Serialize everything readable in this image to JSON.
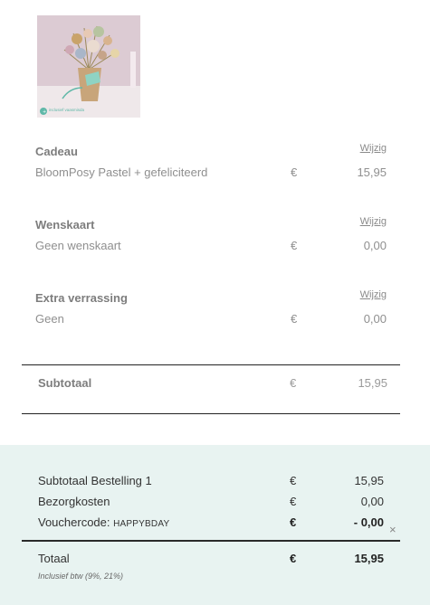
{
  "product": {
    "image_badge": "inclusief vaasmisda"
  },
  "sections": [
    {
      "title": "Cadeau",
      "edit_label": "Wijzig",
      "description": "BloomPosy Pastel + gefeliciteerd",
      "currency": "€",
      "price": "15,95"
    },
    {
      "title": "Wenskaart",
      "edit_label": "Wijzig",
      "description": "Geen wenskaart",
      "currency": "€",
      "price": "0,00"
    },
    {
      "title": "Extra verrassing",
      "edit_label": "Wijzig",
      "description": "Geen",
      "currency": "€",
      "price": "0,00"
    }
  ],
  "subtotal": {
    "label": "Subtotaal",
    "currency": "€",
    "price": "15,95"
  },
  "summary": {
    "order_subtotal": {
      "label": "Subtotaal Bestelling 1",
      "currency": "€",
      "price": "15,95"
    },
    "shipping": {
      "label": "Bezorgkosten",
      "currency": "€",
      "price": "0,00"
    },
    "voucher": {
      "label": "Vouchercode: ",
      "code": "HAPPYBDAY",
      "currency": "€",
      "price": "- 0,00",
      "remove": "×"
    },
    "total": {
      "label": "Totaal",
      "currency": "€",
      "price": "15,95"
    },
    "vat_note": "Inclusief btw (9%, 21%)"
  },
  "colors": {
    "summary_bg": "#e8f3f1",
    "badge_accent": "#5fb8a8"
  }
}
